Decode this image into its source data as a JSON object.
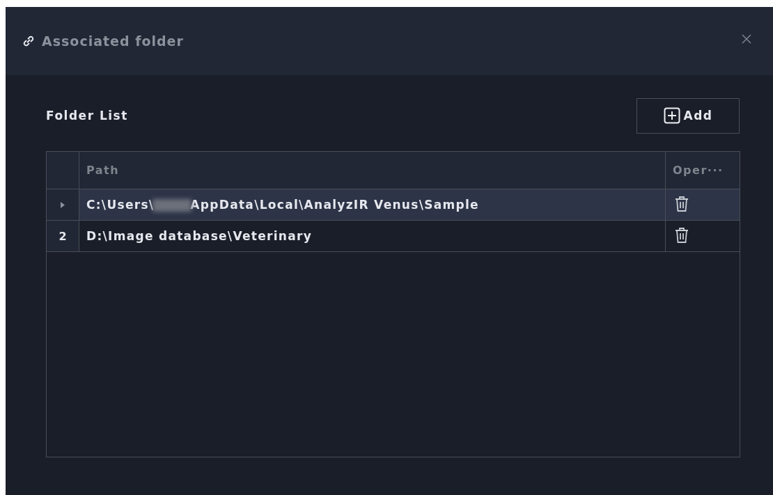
{
  "window": {
    "title": "Associated folder"
  },
  "folder_list": {
    "title": "Folder List",
    "add_button": "Add"
  },
  "table": {
    "columns": [
      {
        "label": "Path"
      },
      {
        "label": "Oper···"
      }
    ],
    "rows": [
      {
        "selected": true,
        "path_parts": [
          "C:\\Users\\",
          "AppData\\Local\\AnalyzIR Venus\\Sample"
        ]
      },
      {
        "selected": false,
        "number": "2",
        "path_parts": [
          "D:\\Image database\\Veterinary"
        ]
      }
    ]
  }
}
